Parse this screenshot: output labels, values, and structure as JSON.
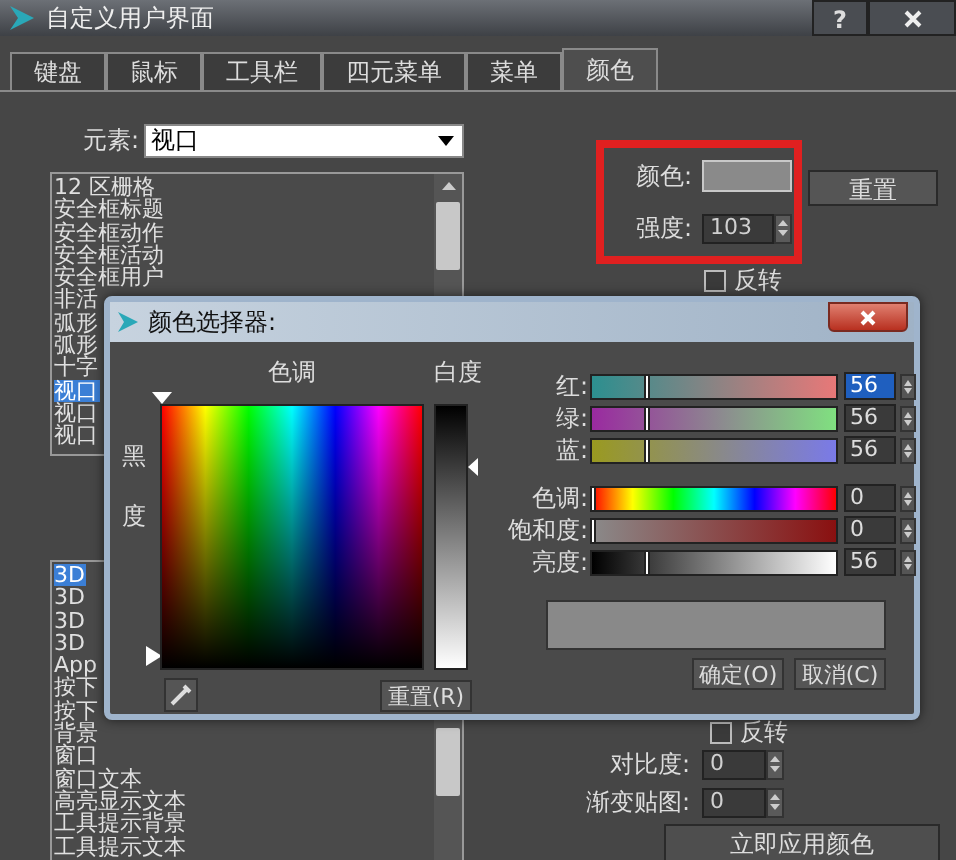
{
  "window": {
    "title": "自定义用户界面",
    "help_label": "?"
  },
  "tabs": [
    {
      "label": "键盘",
      "selected": false
    },
    {
      "label": "鼠标",
      "selected": false
    },
    {
      "label": "工具栏",
      "selected": false
    },
    {
      "label": "四元菜单",
      "selected": false
    },
    {
      "label": "菜单",
      "selected": false
    },
    {
      "label": "颜色",
      "selected": true
    }
  ],
  "element_field": {
    "label": "元素:",
    "value": "视口"
  },
  "element_list": {
    "items": [
      {
        "label": "12 区栅格",
        "selected": false
      },
      {
        "label": "安全框标题",
        "selected": false
      },
      {
        "label": "安全框动作",
        "selected": false
      },
      {
        "label": "安全框活动",
        "selected": false
      },
      {
        "label": "安全框用户",
        "selected": false
      },
      {
        "label": "非活",
        "selected": false
      },
      {
        "label": "弧形",
        "selected": false
      },
      {
        "label": "弧形",
        "selected": false
      },
      {
        "label": "十字",
        "selected": false
      },
      {
        "label": "视口",
        "selected": true
      },
      {
        "label": "视口",
        "selected": false
      },
      {
        "label": "视口",
        "selected": false
      }
    ]
  },
  "ui_list": {
    "items": [
      {
        "label": "3D",
        "selected": true
      },
      {
        "label": "3D",
        "selected": false
      },
      {
        "label": "3D",
        "selected": false
      },
      {
        "label": "3D",
        "selected": false
      },
      {
        "label": "App",
        "selected": false
      },
      {
        "label": "按下",
        "selected": false
      },
      {
        "label": "按下",
        "selected": false
      },
      {
        "label": "背景",
        "selected": false
      },
      {
        "label": "窗口",
        "selected": false
      },
      {
        "label": "窗口文本",
        "selected": false
      },
      {
        "label": "高亮显示文本",
        "selected": false
      },
      {
        "label": "工具提示背景",
        "selected": false
      },
      {
        "label": "工具提示文本",
        "selected": false
      }
    ]
  },
  "color_label": "颜色:",
  "reset_button": "重置",
  "intensity": {
    "label": "强度:",
    "value": "103"
  },
  "invert_top": {
    "label": "反转",
    "checked": false
  },
  "invert_bottom": {
    "label": "反转",
    "checked": false
  },
  "contrast": {
    "label": "对比度:",
    "value": "0"
  },
  "gradient_map": {
    "label": "渐变贴图:",
    "value": "0"
  },
  "apply_button": "立即应用颜色",
  "color_picker": {
    "title": "颜色选择器:",
    "hue_label": "色调",
    "whiteness_label": "白度",
    "blackness_label": "黑度",
    "sliders": [
      {
        "kind": "red",
        "label": "红:",
        "level": 0.22,
        "value": "56",
        "highlighted": true
      },
      {
        "kind": "green",
        "label": "绿:",
        "level": 0.22,
        "value": "56",
        "highlighted": false
      },
      {
        "kind": "blue",
        "label": "蓝:",
        "level": 0.22,
        "value": "56",
        "highlighted": false
      },
      {
        "kind": "hue",
        "label": "色调:",
        "level": 0,
        "value": "0",
        "highlighted": false
      },
      {
        "kind": "saturation",
        "label": "饱和度:",
        "level": 0,
        "value": "0",
        "highlighted": false
      },
      {
        "kind": "brightness",
        "label": "亮度:",
        "level": 0.22,
        "value": "56",
        "highlighted": false
      }
    ],
    "reset_button": "重置(R)",
    "ok_button": "确定(O)",
    "cancel_button": "取消(C)"
  }
}
